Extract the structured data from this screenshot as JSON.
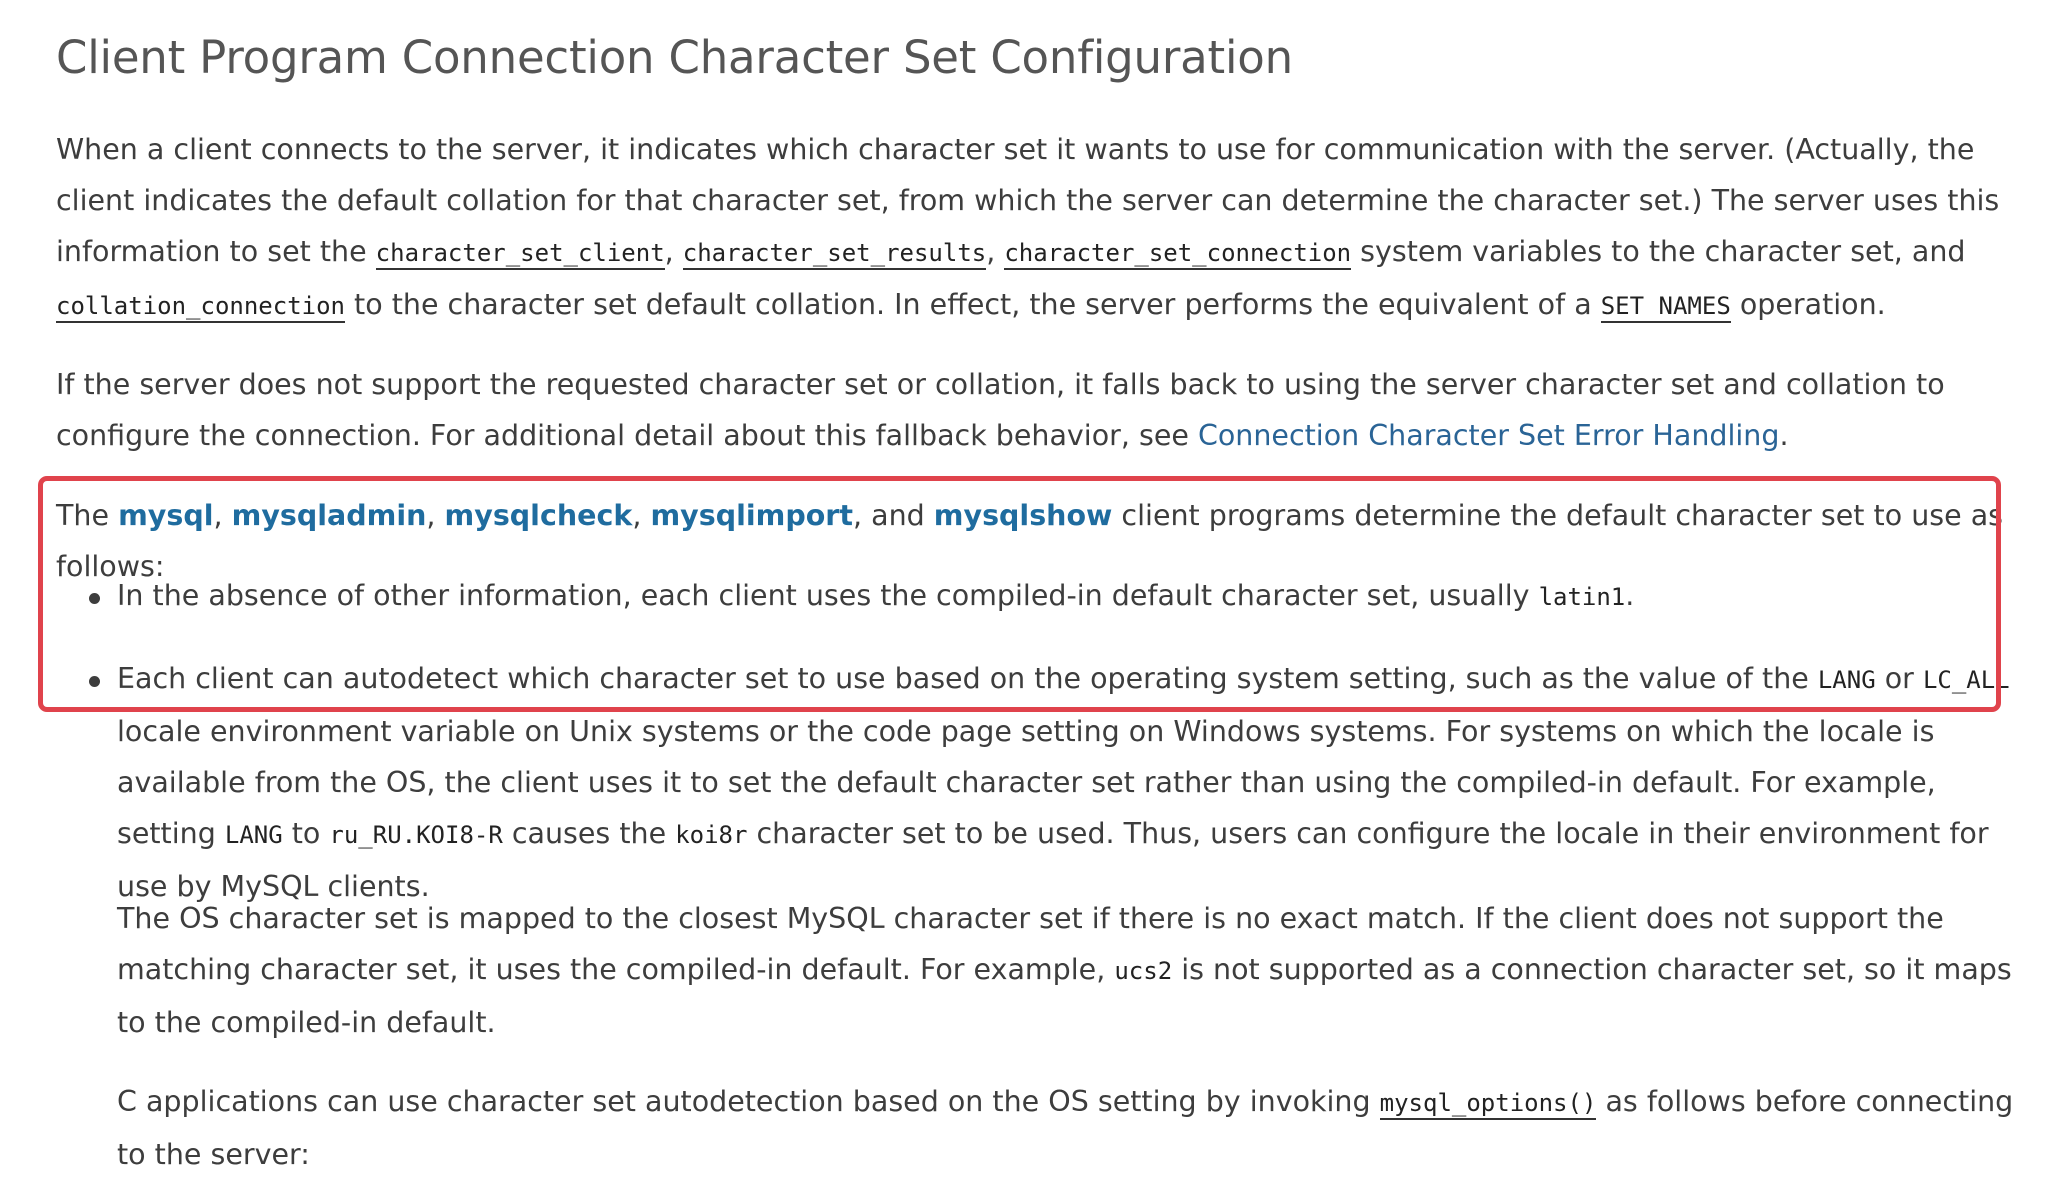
{
  "title": "Client Program Connection Character Set Configuration",
  "p1": {
    "t1": "When a client connects to the server, it indicates which character set it wants to use for communication with the server. (Actually, the client indicates the default collation for that character set, from which the server can determine the character set.) The server uses this information to set the ",
    "c1": "character_set_client",
    "s1": ", ",
    "c2": "character_set_results",
    "s2": ", ",
    "c3": "character_set_connection",
    "t2": " system variables to the character set, and ",
    "c4": "collation_connection",
    "t3": " to the character set default collation. In effect, the server performs the equivalent of a ",
    "c5": "SET NAMES",
    "t4": " operation."
  },
  "p2": {
    "t1": "If the server does not support the requested character set or collation, it falls back to using the server character set and collation to configure the connection. For additional detail about this fallback behavior, see ",
    "link": "Connection Character Set Error Handling",
    "t2": "."
  },
  "p3": {
    "t1": "The ",
    "prog1": "mysql",
    "s1": ", ",
    "prog2": "mysqladmin",
    "s2": ", ",
    "prog3": "mysqlcheck",
    "s3": ", ",
    "prog4": "mysqlimport",
    "s4": ", and ",
    "prog5": "mysqlshow",
    "t2": " client programs determine the default character set to use as follows:"
  },
  "bullet1": {
    "t1": "In the absence of other information, each client uses the compiled-in default character set, usually ",
    "c1": "latin1",
    "t2": "."
  },
  "bullet2": {
    "t1": "Each client can autodetect which character set to use based on the operating system setting, such as the value of the ",
    "c1": "LANG",
    "t2": " or ",
    "c2": "LC_ALL",
    "t3": " locale environment variable on Unix systems or the code page setting on Windows systems. For systems on which the locale is available from the OS, the client uses it to set the default character set rather than using the compiled-in default. For example, setting ",
    "c3": "LANG",
    "t4": " to ",
    "c4": "ru_RU.KOI8-R",
    "t5": " causes the ",
    "c5": "koi8r",
    "t6": " character set to be used. Thus, users can configure the locale in their environment for use by MySQL clients."
  },
  "p4": {
    "t1": "The OS character set is mapped to the closest MySQL character set if there is no exact match. If the client does not support the matching character set, it uses the compiled-in default. For example, ",
    "c1": "ucs2",
    "t2": " is not supported as a connection character set, so it maps to the compiled-in default."
  },
  "p5": {
    "t1": "C applications can use character set autodetection based on the OS setting by invoking ",
    "c1": "mysql_options()",
    "t2": " as follows before connecting to the server:"
  },
  "colors": {
    "link": "#2a6496",
    "program_link": "#1f6c9f",
    "highlight_border": "#e0434c",
    "text": "#3d3d3d"
  }
}
